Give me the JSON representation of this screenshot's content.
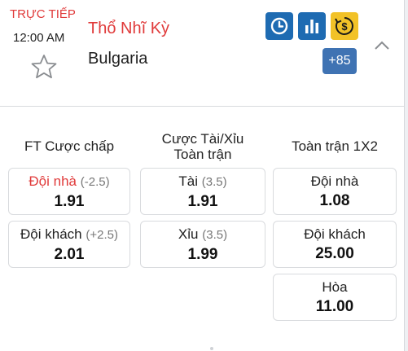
{
  "match": {
    "live_label": "TRỰC TIẾP",
    "time": "12:00 AM",
    "home_team": "Thổ Nhĩ Kỳ",
    "away_team": "Bulgaria",
    "more_markets": "+85"
  },
  "icons": {
    "favorite": "star-outline-icon",
    "timeline": "clock-icon",
    "stats": "bar-chart-icon",
    "cash_out": "cash-out-icon",
    "collapse": "chevron-up-icon"
  },
  "colors": {
    "live_red": "#e03a3a",
    "icon_blue": "#1e6bb2",
    "cash_gold": "#f2c227",
    "more_blue": "#3f73b3"
  },
  "markets": {
    "handicap": {
      "title": "FT Cược chấp",
      "home": {
        "label": "Đội nhà",
        "handicap": "(-2.5)",
        "price": "1.91"
      },
      "away": {
        "label": "Đội khách",
        "handicap": "(+2.5)",
        "price": "2.01"
      }
    },
    "over_under": {
      "title_line1": "Cược Tài/Xỉu",
      "title_line2": "Toàn trận",
      "over": {
        "label": "Tài",
        "line": "(3.5)",
        "price": "1.91"
      },
      "under": {
        "label": "Xỉu",
        "line": "(3.5)",
        "price": "1.99"
      }
    },
    "one_x_two": {
      "title": "Toàn trận 1X2",
      "home": {
        "label": "Đội nhà",
        "price": "1.08"
      },
      "away": {
        "label": "Đội khách",
        "price": "25.00"
      },
      "draw": {
        "label": "Hòa",
        "price": "11.00"
      }
    }
  }
}
